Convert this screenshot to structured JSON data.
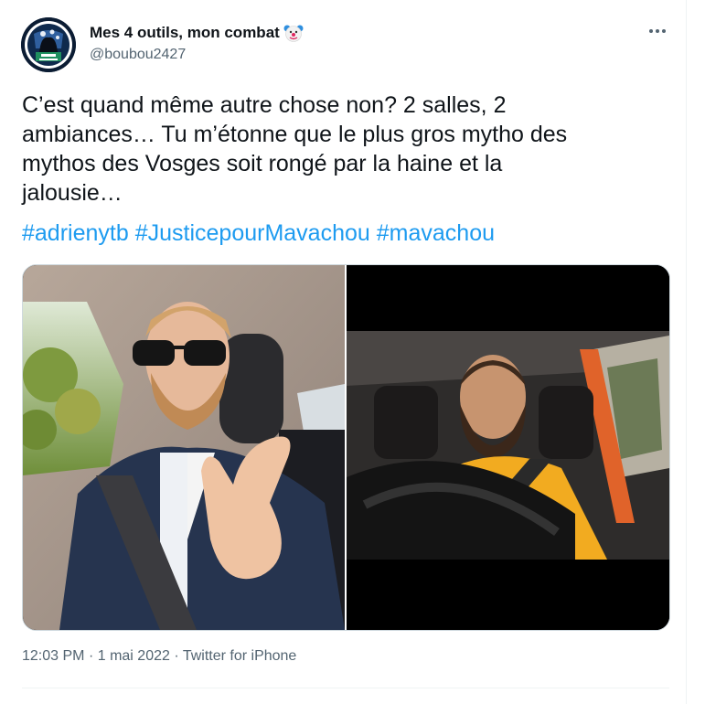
{
  "author": {
    "display_name": "Mes 4 outils, mon combat",
    "handle": "@boubou2427",
    "name_emoji": "clown-face-icon",
    "avatar": "avatar-cat-des-vosges-icon"
  },
  "tweet": {
    "text_lines": [
      "C’est quand même autre chose non? 2 salles, 2",
      "ambiances… Tu m’étonne que le plus gros mytho des",
      "mythos des Vosges soit rongé par la haine et la",
      "jalousie…"
    ],
    "hashtags": [
      "#adrienytb",
      "#JusticepourMavachou",
      "#mavachou"
    ],
    "time": "12:03 PM",
    "date": "1 mai 2022",
    "source": "Twitter for iPhone",
    "separator": "·"
  },
  "media": [
    {
      "description_icon": "photo-man-sunglasses-car-icon"
    },
    {
      "description_icon": "photo-bearded-man-driving-icon"
    }
  ],
  "colors": {
    "link": "#1d9bf0",
    "secondary_text": "#536471",
    "primary_text": "#0f1419",
    "border": "#cfd9de"
  }
}
